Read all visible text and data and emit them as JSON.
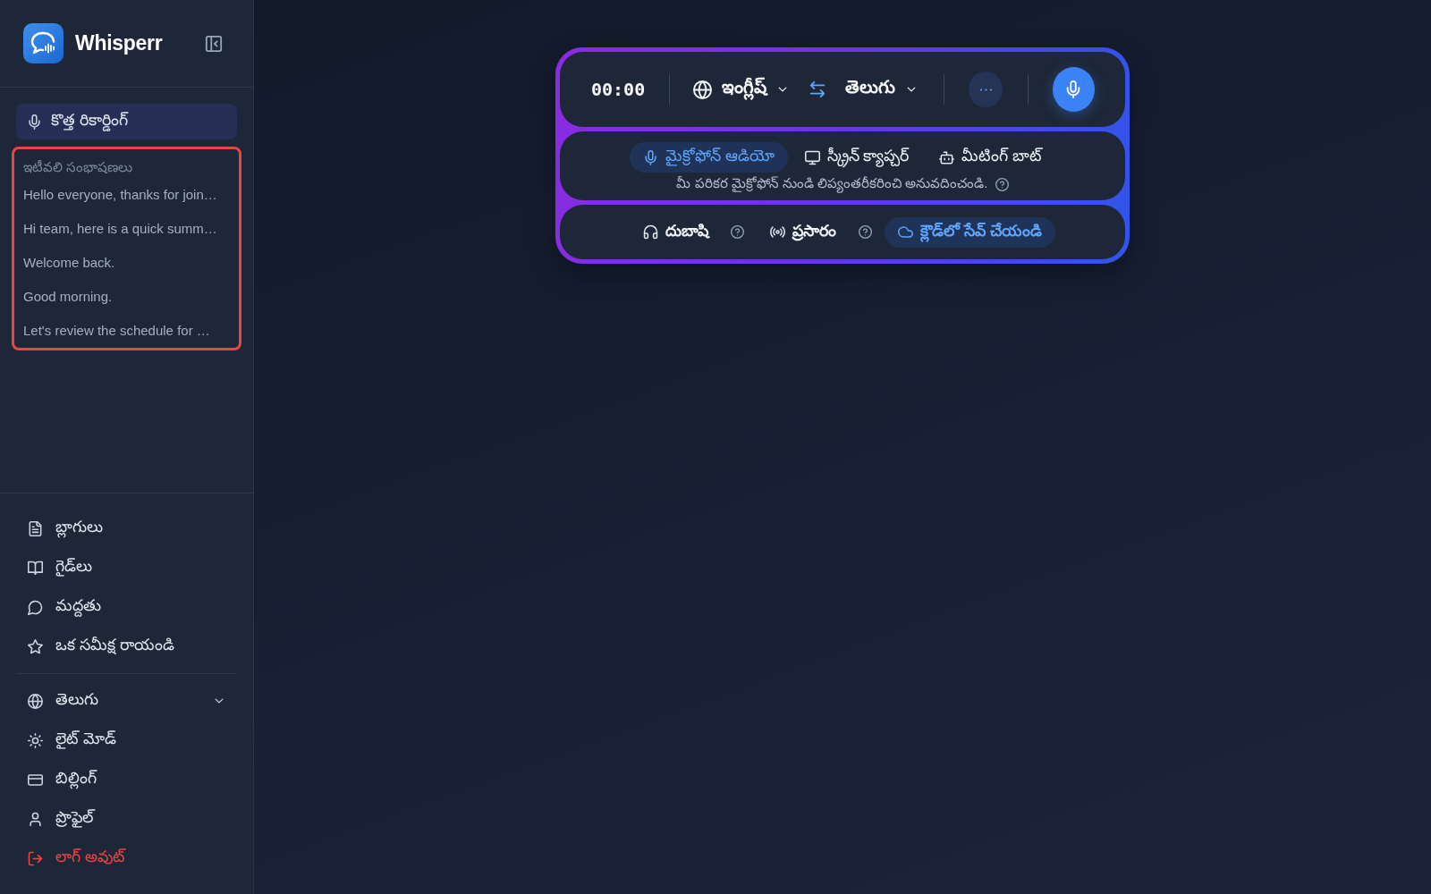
{
  "sidebar": {
    "brand": {
      "name": "Whisperr"
    },
    "new_recording": {
      "label": "కొత్త రికార్డింగ్"
    },
    "recent": {
      "heading": "ఇటీవలి సంభాషణలు",
      "highlighted": true,
      "items": [
        "Hello everyone, thanks for join…",
        "Hi team, here is a quick summ…",
        "Welcome back.",
        "Good morning.",
        "Let's review the schedule for …"
      ]
    },
    "links": [
      {
        "label": "బ్లాగులు"
      },
      {
        "label": "గైడ్‌లు"
      },
      {
        "label": "మద్దతు"
      },
      {
        "label": "ఒక సమీక్ష రాయండి"
      }
    ],
    "settings": [
      {
        "label": "తెలుగు",
        "kind": "dropdown"
      },
      {
        "label": "లైట్ మోడ్",
        "kind": "link"
      },
      {
        "label": "బిల్లింగ్",
        "kind": "link"
      },
      {
        "label": "ప్రొఫైల్",
        "kind": "link"
      },
      {
        "label": "లాగ్ అవుట్",
        "kind": "danger"
      }
    ]
  },
  "recorder": {
    "timer": "00:00",
    "source_language": "ఇంగ్లీష్",
    "target_language": "తెలుగు",
    "input_modes": [
      {
        "label": "మైక్రోఫోన్ ఆడియో",
        "selected": true
      },
      {
        "label": "స్క్రీన్ క్యాప్చర్",
        "selected": false
      },
      {
        "label": "మీటింగ్ బాట్",
        "selected": false
      }
    ],
    "mode_description": "మీ పరికర మైక్రోఫోన్ నుండి లిప్యంతరీకరించి అనువదించండి.",
    "options": [
      {
        "label": "దుబాషి",
        "on": false,
        "help": true
      },
      {
        "label": "ప్రసారం",
        "on": false,
        "help": true
      },
      {
        "label": "క్లౌడ్‌లో సేవ్ చేయండి",
        "on": true,
        "help": false
      }
    ]
  }
}
